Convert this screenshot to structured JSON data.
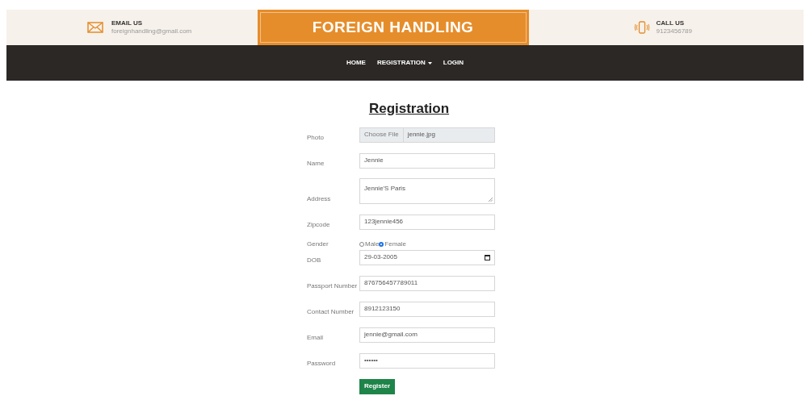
{
  "header": {
    "email": {
      "label": "EMAIL US",
      "value": "foreignhandling@gmail.com"
    },
    "brand": "FOREIGN HANDLING",
    "call": {
      "label": "CALL US",
      "value": "9123456789"
    }
  },
  "nav": [
    {
      "label": "HOME",
      "dropdown": false
    },
    {
      "label": "REGISTRATION",
      "dropdown": true
    },
    {
      "label": "LOGIN",
      "dropdown": false
    }
  ],
  "form": {
    "title": "Registration",
    "fields": [
      {
        "kind": "file",
        "label": "Photo",
        "button": "Choose File",
        "value": "jennie.jpg"
      },
      {
        "kind": "text",
        "label": "Name",
        "value": "Jennie"
      },
      {
        "kind": "textarea",
        "label": "Address",
        "value": "Jennie'S Paris"
      },
      {
        "kind": "text",
        "label": "Zipcode",
        "value": "123jennie456"
      },
      {
        "kind": "radio",
        "label": "Gender",
        "options": [
          {
            "label": "Male",
            "selected": false
          },
          {
            "label": "Female",
            "selected": true
          }
        ]
      },
      {
        "kind": "date",
        "label": "DOB",
        "value": "29-03-2005"
      },
      {
        "kind": "text",
        "label": "Passport Number",
        "value": "876756457789011"
      },
      {
        "kind": "text",
        "label": "Contact Number",
        "value": "8912123150"
      },
      {
        "kind": "text",
        "label": "Email",
        "value": "jennie@gmail.com"
      },
      {
        "kind": "password",
        "label": "Password",
        "value": "••••••"
      }
    ],
    "submit": "Register"
  }
}
